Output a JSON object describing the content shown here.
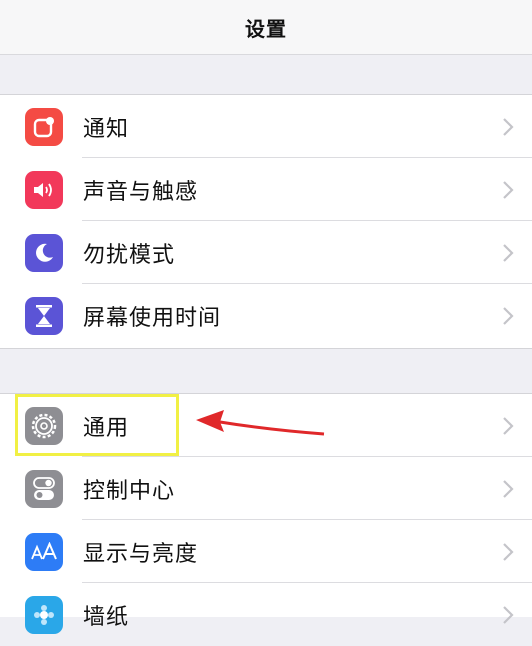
{
  "navbar": {
    "title": "设置"
  },
  "group1": [
    {
      "label": "通知",
      "icon": "notification-icon",
      "color": "#f44b44"
    },
    {
      "label": "声音与触感",
      "icon": "speaker-icon",
      "color": "#f2385a"
    },
    {
      "label": "勿扰模式",
      "icon": "moon-icon",
      "color": "#5b54d6"
    },
    {
      "label": "屏幕使用时间",
      "icon": "hourglass-icon",
      "color": "#5b54d6"
    }
  ],
  "group2": [
    {
      "label": "通用",
      "icon": "gear-icon",
      "color": "#8e8e93"
    },
    {
      "label": "控制中心",
      "icon": "toggles-icon",
      "color": "#8e8e93"
    },
    {
      "label": "显示与亮度",
      "icon": "text-size-icon",
      "color": "#2d7cf6"
    },
    {
      "label": "墙纸",
      "icon": "wallpaper-icon",
      "color": "#2aa7e8"
    }
  ],
  "annotation": {
    "highlight_color": "#f1f044",
    "arrow_color": "#e0282a"
  }
}
